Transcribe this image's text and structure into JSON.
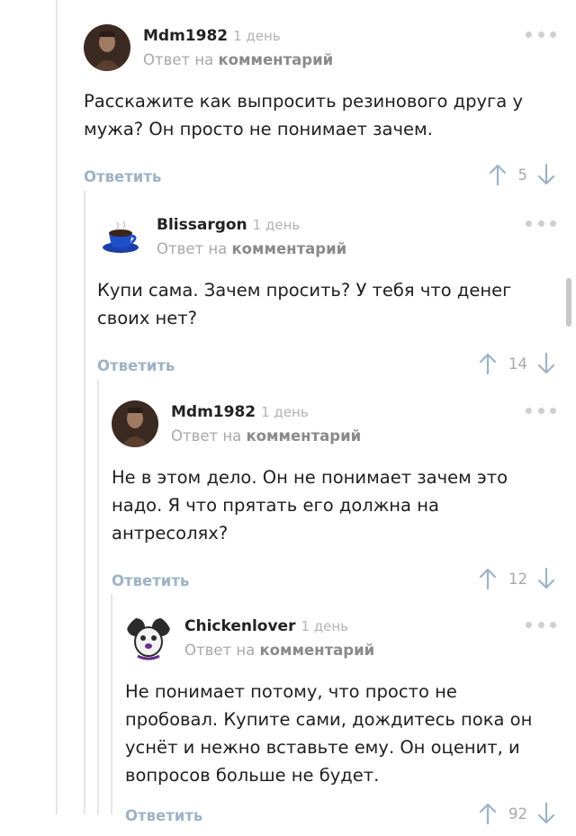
{
  "comments": [
    {
      "author": "Mdm1982",
      "age": "1 день",
      "reply_prefix": "Ответ на",
      "reply_link": "комментарий",
      "text": "Расскажите как выпросить резинового друга у мужа? Он просто не понимает зачем.",
      "reply_label": "Ответить",
      "votes": "5",
      "avatar_icon": "photo-avatar-icon"
    },
    {
      "author": "Blissargon",
      "age": "1 день",
      "reply_prefix": "Ответ на",
      "reply_link": "комментарий",
      "text": "Купи сама. Зачем просить? У тебя что денег своих нет?",
      "reply_label": "Ответить",
      "votes": "14",
      "avatar_icon": "coffee-cup-avatar-icon"
    },
    {
      "author": "Mdm1982",
      "age": "1 день",
      "reply_prefix": "Ответ на",
      "reply_link": "комментарий",
      "text": "Не в этом дело. Он не понимает зачем это надо. Я что прятать его должна на антресолях?",
      "reply_label": "Ответить",
      "votes": "12",
      "avatar_icon": "photo-avatar-icon"
    },
    {
      "author": "Chickenlover",
      "age": "1 день",
      "reply_prefix": "Ответ на",
      "reply_link": "комментарий",
      "text": "Не понимает потому, что просто не пробовал. Купите сами, дождитесь пока он уснёт и нежно вставьте ему. Он оценит, и вопросов больше не будет.",
      "reply_label": "Ответить",
      "votes": "92",
      "avatar_icon": "cartoon-mouse-avatar-icon"
    }
  ]
}
